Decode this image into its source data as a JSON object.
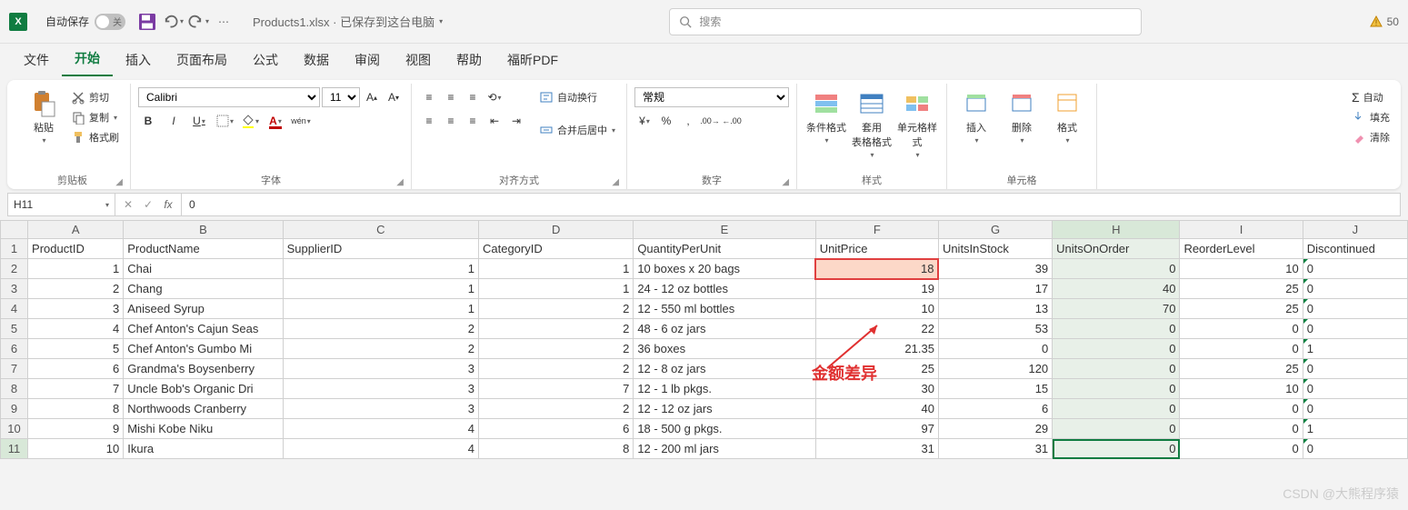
{
  "titlebar": {
    "autosave_label": "自动保存",
    "autosave_state": "关",
    "doc_title": "Products1.xlsx · 已保存到这台电脑",
    "search_placeholder": "搜索",
    "warn_count": "50"
  },
  "tabs": [
    "文件",
    "开始",
    "插入",
    "页面布局",
    "公式",
    "数据",
    "审阅",
    "视图",
    "帮助",
    "福昕PDF"
  ],
  "active_tab": 1,
  "ribbon": {
    "clipboard": {
      "paste": "粘贴",
      "cut": "剪切",
      "copy": "复制",
      "format_painter": "格式刷",
      "label": "剪贴板"
    },
    "font": {
      "name": "Calibri",
      "size": "11",
      "label": "字体",
      "phonetic": "wén"
    },
    "align": {
      "wrap": "自动换行",
      "merge": "合并后居中",
      "label": "对齐方式"
    },
    "number": {
      "format": "常规",
      "label": "数字"
    },
    "styles": {
      "cond": "条件格式",
      "table": "套用\n表格格式",
      "cell": "单元格样式",
      "label": "样式"
    },
    "cells": {
      "insert": "插入",
      "delete": "删除",
      "format": "格式",
      "label": "单元格"
    },
    "editing": {
      "autosum": "自动",
      "fill": "填充",
      "clear": "清除"
    }
  },
  "formula_bar": {
    "name_box": "H11",
    "value": "0"
  },
  "columns": [
    "A",
    "B",
    "C",
    "D",
    "E",
    "F",
    "G",
    "H",
    "I",
    "J"
  ],
  "headers": [
    "ProductID",
    "ProductName",
    "SupplierID",
    "CategoryID",
    "QuantityPerUnit",
    "UnitPrice",
    "UnitsInStock",
    "UnitsOnOrder",
    "ReorderLevel",
    "Discontinued"
  ],
  "chart_data": {
    "type": "table",
    "columns": [
      "ProductID",
      "ProductName",
      "SupplierID",
      "CategoryID",
      "QuantityPerUnit",
      "UnitPrice",
      "UnitsInStock",
      "UnitsOnOrder",
      "ReorderLevel",
      "Discontinued"
    ],
    "rows": [
      [
        1,
        "Chai",
        1,
        1,
        "10 boxes x 20 bags",
        18,
        39,
        0,
        10,
        0
      ],
      [
        2,
        "Chang",
        1,
        1,
        "24 - 12 oz bottles",
        19,
        17,
        40,
        25,
        0
      ],
      [
        3,
        "Aniseed Syrup",
        1,
        2,
        "12 - 550 ml bottles",
        10,
        13,
        70,
        25,
        0
      ],
      [
        4,
        "Chef Anton's Cajun Seas",
        2,
        2,
        "48 - 6 oz jars",
        22,
        53,
        0,
        0,
        0
      ],
      [
        5,
        "Chef Anton's Gumbo Mi",
        2,
        2,
        "36 boxes",
        21.35,
        0,
        0,
        0,
        1
      ],
      [
        6,
        "Grandma's Boysenberry",
        3,
        2,
        "12 - 8 oz jars",
        25,
        120,
        0,
        25,
        0
      ],
      [
        7,
        "Uncle Bob's Organic Dri",
        3,
        7,
        "12 - 1 lb pkgs.",
        30,
        15,
        0,
        10,
        0
      ],
      [
        8,
        "Northwoods Cranberry",
        3,
        2,
        "12 - 12 oz jars",
        40,
        6,
        0,
        0,
        0
      ],
      [
        9,
        "Mishi Kobe Niku",
        4,
        6,
        "18 - 500 g pkgs.",
        97,
        29,
        0,
        0,
        1
      ],
      [
        10,
        "Ikura",
        4,
        8,
        "12 - 200 ml jars",
        31,
        31,
        0,
        0,
        0
      ]
    ]
  },
  "annotation": "金额差异",
  "watermark": "CSDN @大熊程序猿",
  "selected_cell": {
    "row": 11,
    "col": "H"
  },
  "highlighted_cell": {
    "row": 2,
    "col": "F"
  }
}
